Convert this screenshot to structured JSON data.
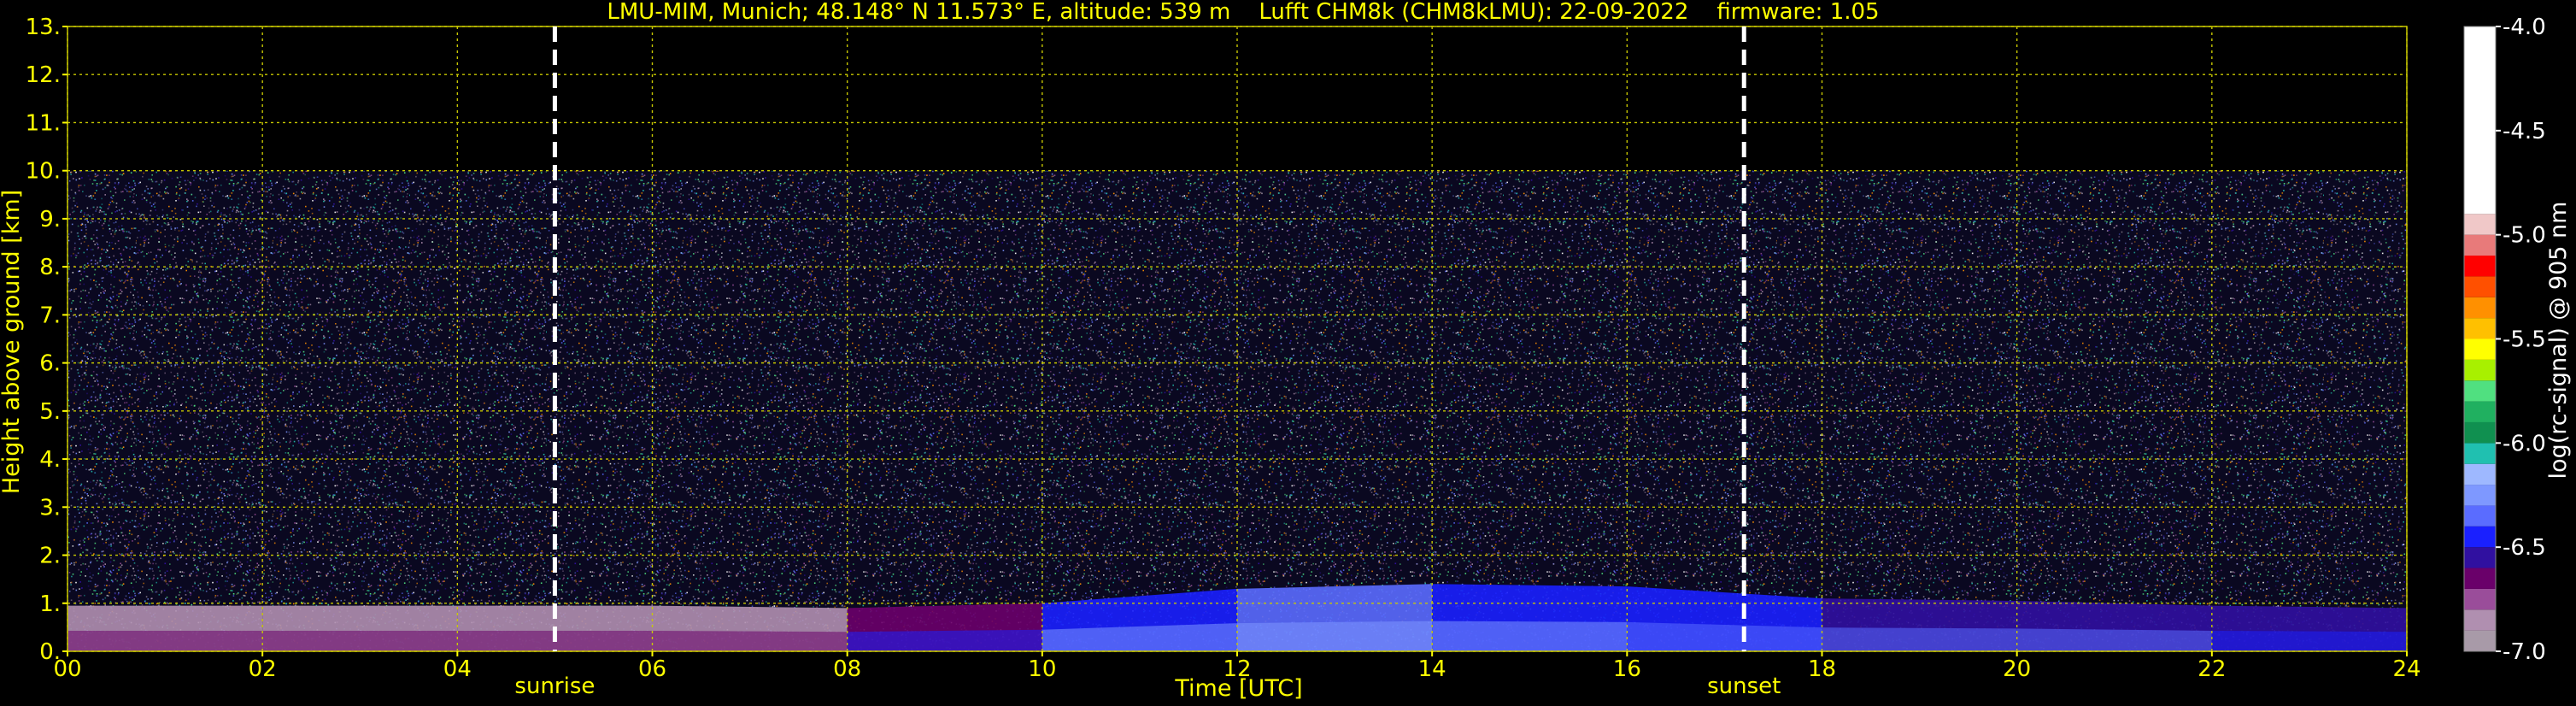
{
  "chart_data": {
    "type": "heatmap",
    "title": "LMU-MIM, Munich; 48.148° N 11.573° E, altitude: 539 m    Lufft CHM8k (CHM8kLMU): 22-09-2022    firmware: 1.05",
    "xlabel": "Time [UTC]",
    "ylabel": "Height above ground [km]",
    "xlim": [
      0,
      24
    ],
    "ylim": [
      0,
      13
    ],
    "x_ticks": [
      0,
      2,
      4,
      6,
      8,
      10,
      12,
      14,
      16,
      18,
      20,
      22,
      24
    ],
    "x_tick_labels": [
      "00",
      "02",
      "04",
      "06",
      "08",
      "10",
      "12",
      "14",
      "16",
      "18",
      "20",
      "22",
      "24"
    ],
    "y_ticks": [
      0,
      1,
      2,
      3,
      4,
      5,
      6,
      7,
      8,
      9,
      10,
      11,
      12,
      13
    ],
    "y_tick_labels": [
      "0.",
      "1.",
      "2.",
      "3.",
      "4.",
      "5.",
      "6.",
      "7.",
      "8.",
      "9.",
      "10.",
      "11.",
      "12.",
      "13."
    ],
    "grid": true,
    "data_top_km": 10,
    "events": [
      {
        "label": "sunrise",
        "time_utc": 5.0
      },
      {
        "label": "sunset",
        "time_utc": 17.2
      }
    ],
    "colorbar": {
      "label": "log(rc-signal) @ 905 nm",
      "range": [
        -7.0,
        -4.0
      ],
      "ticks": [
        -4.0,
        -4.5,
        -5.0,
        -5.5,
        -6.0,
        -6.5,
        -7.0
      ],
      "tick_labels": [
        "-4.0",
        "-4.5",
        "-5.0",
        "-5.5",
        "-6.0",
        "-6.5",
        "-7.0"
      ],
      "levels": [
        {
          "from": -7.0,
          "color": "#a89aa8"
        },
        {
          "from": -6.9,
          "color": "#b08fb0"
        },
        {
          "from": -6.8,
          "color": "#9a4d9a"
        },
        {
          "from": -6.7,
          "color": "#6a006a"
        },
        {
          "from": -6.6,
          "color": "#3010a0"
        },
        {
          "from": -6.5,
          "color": "#1a20ff"
        },
        {
          "from": -6.4,
          "color": "#5a6cff"
        },
        {
          "from": -6.3,
          "color": "#7e98ff"
        },
        {
          "from": -6.2,
          "color": "#9eb8ff"
        },
        {
          "from": -6.1,
          "color": "#20c0b0"
        },
        {
          "from": -6.0,
          "color": "#109050"
        },
        {
          "from": -5.9,
          "color": "#20b060"
        },
        {
          "from": -5.8,
          "color": "#50e080"
        },
        {
          "from": -5.7,
          "color": "#a8f000"
        },
        {
          "from": -5.6,
          "color": "#ffff00"
        },
        {
          "from": -5.5,
          "color": "#ffc000"
        },
        {
          "from": -5.4,
          "color": "#ff9000"
        },
        {
          "from": -5.3,
          "color": "#ff5000"
        },
        {
          "from": -5.2,
          "color": "#ff0000"
        },
        {
          "from": -5.1,
          "color": "#e87a7a"
        },
        {
          "from": -5.0,
          "color": "#f0c8c8"
        },
        {
          "from": -4.9,
          "color": "#ffffff"
        }
      ]
    },
    "boundary_layer": [
      {
        "t": 0,
        "top": 0.95,
        "level": -6.85
      },
      {
        "t": 2,
        "top": 0.95,
        "level": -6.85
      },
      {
        "t": 4,
        "top": 0.95,
        "level": -6.85
      },
      {
        "t": 6,
        "top": 0.95,
        "level": -6.85
      },
      {
        "t": 8,
        "top": 0.9,
        "level": -6.8
      },
      {
        "t": 10,
        "top": 1.0,
        "level": -6.5
      },
      {
        "t": 12,
        "top": 1.3,
        "level": -6.4
      },
      {
        "t": 14,
        "top": 1.4,
        "level": -6.4
      },
      {
        "t": 16,
        "top": 1.35,
        "level": -6.45
      },
      {
        "t": 18,
        "top": 1.1,
        "level": -6.55
      },
      {
        "t": 20,
        "top": 1.05,
        "level": -6.5
      },
      {
        "t": 22,
        "top": 0.95,
        "level": -6.6
      },
      {
        "t": 24,
        "top": 0.9,
        "level": -6.6
      }
    ],
    "colors": {
      "background": "#000000",
      "text": "#ffff00",
      "grid": "#c8c800",
      "event_line": "#ffffff",
      "colorbar_text": "#ffffff"
    }
  }
}
